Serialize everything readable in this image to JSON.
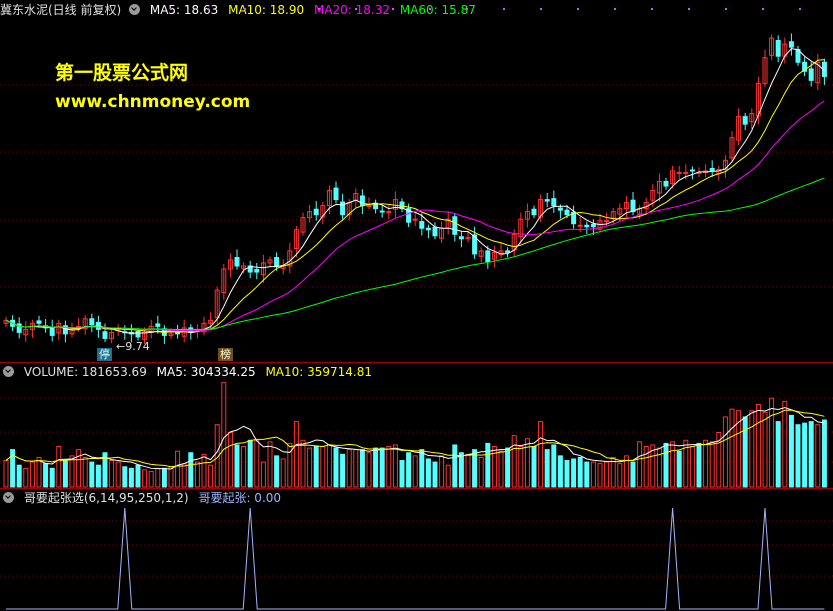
{
  "main": {
    "stock_name": "冀东水泥(日线 前复权)",
    "ma5_label": "MA5: 18.63",
    "ma10_label": "MA10: 18.90",
    "ma20_label": "MA20: 18.32",
    "ma60_label": "MA60: 15.87",
    "watermark_cn": "第一股票公式网",
    "watermark_url": "www.chnmoney.com",
    "low_marker": "9.74",
    "tag_limit": "停",
    "tag_list": "榜"
  },
  "volume": {
    "volume_label": "VOLUME: 181653.69",
    "ma5_label": "MA5: 304334.25",
    "ma10_label": "MA10: 359714.81"
  },
  "indicator": {
    "name_label": "哥要起张选(6,14,95,250,1,2)",
    "value_label": "哥要起张: 0.00"
  },
  "colors": {
    "up": "#ff3232",
    "down": "#54ffff",
    "ma5": "#ffffff",
    "ma10": "#ffff00",
    "ma20": "#ff00ff",
    "ma60": "#00ff00",
    "indicator_line": "#9fb6ff"
  },
  "chart_data": {
    "type": "candlestick",
    "price_closes": [
      10.55,
      10.35,
      10.15,
      10.25,
      10.45,
      10.45,
      10.3,
      10.05,
      10.45,
      10.1,
      10.25,
      10.35,
      10.6,
      10.4,
      10.25,
      9.95,
      10.15,
      10.25,
      10.15,
      10.1,
      10.0,
      10.15,
      10.35,
      10.35,
      10.05,
      10.1,
      10.1,
      10.3,
      10.15,
      10.25,
      10.45,
      10.55,
      11.55,
      12.25,
      12.55,
      12.35,
      12.35,
      12.15,
      12.15,
      12.45,
      12.55,
      12.35,
      12.35,
      12.85,
      13.55,
      13.95,
      14.15,
      14.05,
      14.35,
      14.85,
      14.55,
      14.05,
      14.45,
      14.75,
      14.35,
      14.35,
      14.25,
      14.15,
      14.15,
      14.55,
      14.25,
      13.8,
      13.9,
      13.6,
      13.55,
      13.35,
      13.6,
      13.9,
      13.4,
      13.25,
      13.3,
      12.75,
      12.85,
      12.5,
      12.8,
      12.85,
      12.8,
      13.4,
      13.9,
      14.15,
      14.05,
      14.55,
      14.5,
      14.35,
      14.2,
      14.05,
      13.75,
      13.7,
      13.65,
      13.65,
      13.85,
      13.85,
      14.15,
      14.25,
      14.45,
      14.15,
      14.25,
      14.45,
      14.85,
      15.15,
      15.0,
      15.5,
      15.45,
      15.45,
      15.5,
      15.45,
      15.5,
      15.5,
      15.55,
      15.85,
      16.6,
      17.3,
      17.05,
      17.4,
      18.4,
      19.25,
      19.9,
      19.3,
      19.7,
      19.6,
      19.1,
      18.8,
      18.5,
      19.1,
      18.63
    ],
    "price_lim": [
      9.5,
      20.5
    ],
    "volume_values": [
      170000,
      240000,
      140000,
      120000,
      160000,
      190000,
      150000,
      120000,
      260000,
      170000,
      200000,
      240000,
      190000,
      160000,
      140000,
      220000,
      170000,
      160000,
      130000,
      120000,
      140000,
      110000,
      100000,
      120000,
      120000,
      130000,
      230000,
      150000,
      220000,
      160000,
      210000,
      140000,
      400000,
      670000,
      350000,
      270000,
      260000,
      300000,
      300000,
      160000,
      290000,
      200000,
      180000,
      280000,
      420000,
      300000,
      250000,
      260000,
      260000,
      270000,
      250000,
      210000,
      240000,
      240000,
      240000,
      220000,
      250000,
      250000,
      260000,
      270000,
      170000,
      220000,
      200000,
      240000,
      180000,
      160000,
      200000,
      140000,
      270000,
      220000,
      210000,
      240000,
      190000,
      280000,
      260000,
      230000,
      250000,
      330000,
      260000,
      310000,
      260000,
      420000,
      240000,
      270000,
      200000,
      170000,
      180000,
      190000,
      160000,
      160000,
      150000,
      160000,
      190000,
      150000,
      200000,
      160000,
      290000,
      260000,
      270000,
      250000,
      280000,
      290000,
      230000,
      300000,
      260000,
      280000,
      300000,
      290000,
      350000,
      450000,
      500000,
      490000,
      450000,
      490000,
      530000,
      480000,
      570000,
      420000,
      550000,
      460000,
      400000,
      410000,
      420000,
      400000,
      430000
    ],
    "volume_lim": [
      0,
      700000
    ],
    "indicator_peaks": [
      18,
      37,
      101,
      115
    ],
    "indicator_lim": [
      0,
      1
    ]
  }
}
